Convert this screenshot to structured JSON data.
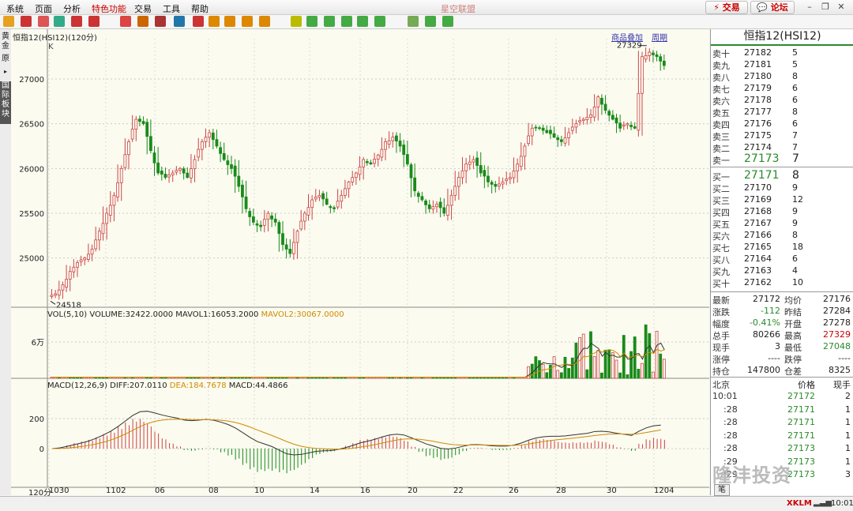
{
  "menu": {
    "items": [
      "系统",
      "页面",
      "分析",
      "特色功能",
      "交易",
      "工具",
      "帮助"
    ],
    "app_title": "星空联盟"
  },
  "topbar": {
    "trade_btn": "交易",
    "forum_btn": "论坛"
  },
  "sidebar": {
    "tab1": "黄金",
    "tab2": "原",
    "tab3": "国际板块"
  },
  "chart_header": {
    "title": "恒指12(HSI12)(120分)",
    "k_label": "K",
    "overlay": "商品叠加",
    "period": "周期",
    "yaxis_label": "120分"
  },
  "volume_header": {
    "prefix": "VOL(5,10)",
    "volume": "VOLUME:32422.0000",
    "mavol1": "MAVOL1:16053.2000",
    "mavol2": "MAVOL2:30067.0000",
    "tick": "6万"
  },
  "macd_header": {
    "prefix": "MACD(12,26,9)",
    "diff": "DIFF:207.0110",
    "dea": "DEA:184.7678",
    "macd": "MACD:44.4866"
  },
  "chart_data": {
    "type": "candlestick",
    "y_ticks": [
      25000,
      25500,
      26000,
      26500,
      27000
    ],
    "ylim": [
      24450,
      27450
    ],
    "x_labels": [
      "1030",
      "1102",
      "06",
      "08",
      "10",
      "14",
      "16",
      "20",
      "22",
      "26",
      "28",
      "30",
      "1204"
    ],
    "annotations": {
      "high": "27329",
      "low": "24518"
    },
    "close_path": [
      24600,
      24700,
      24850,
      24950,
      25000,
      25100,
      25300,
      25500,
      25700,
      26000,
      26300,
      26550,
      26500,
      26200,
      25950,
      25900,
      25950,
      26000,
      25900,
      26100,
      26300,
      26400,
      26250,
      26100,
      26000,
      25800,
      25550,
      25400,
      25350,
      25500,
      25400,
      25150,
      25050,
      25300,
      25500,
      25650,
      25700,
      25600,
      25550,
      25700,
      25850,
      25950,
      26100,
      26050,
      26150,
      26300,
      26350,
      26250,
      26050,
      25750,
      25650,
      25550,
      25600,
      25500,
      25700,
      25900,
      26050,
      26100,
      25950,
      25850,
      25800,
      25850,
      25900,
      26050,
      26250,
      26450,
      26450,
      26400,
      26350,
      26300,
      26400,
      26500,
      26550,
      26600,
      26800,
      26650,
      26550,
      26450,
      26500,
      26450,
      27250,
      27300,
      27250,
      27150
    ],
    "vol_ticks": [
      "6万"
    ],
    "macd_ticks": [
      200,
      0
    ]
  },
  "panel": {
    "title": "恒指12(HSI12)",
    "sells": [
      {
        "label": "卖十",
        "price": "27182",
        "vol": "5"
      },
      {
        "label": "卖九",
        "price": "27181",
        "vol": "5"
      },
      {
        "label": "卖八",
        "price": "27180",
        "vol": "8"
      },
      {
        "label": "卖七",
        "price": "27179",
        "vol": "6"
      },
      {
        "label": "卖六",
        "price": "27178",
        "vol": "6"
      },
      {
        "label": "卖五",
        "price": "27177",
        "vol": "8"
      },
      {
        "label": "卖四",
        "price": "27176",
        "vol": "6"
      },
      {
        "label": "卖三",
        "price": "27175",
        "vol": "7"
      },
      {
        "label": "卖二",
        "price": "27174",
        "vol": "7"
      },
      {
        "label": "卖一",
        "price": "27173",
        "vol": "7"
      }
    ],
    "buys": [
      {
        "label": "买一",
        "price": "27171",
        "vol": "8"
      },
      {
        "label": "买二",
        "price": "27170",
        "vol": "9"
      },
      {
        "label": "买三",
        "price": "27169",
        "vol": "12"
      },
      {
        "label": "买四",
        "price": "27168",
        "vol": "9"
      },
      {
        "label": "买五",
        "price": "27167",
        "vol": "9"
      },
      {
        "label": "买六",
        "price": "27166",
        "vol": "8"
      },
      {
        "label": "买七",
        "price": "27165",
        "vol": "18"
      },
      {
        "label": "买八",
        "price": "27164",
        "vol": "6"
      },
      {
        "label": "买九",
        "price": "27163",
        "vol": "4"
      },
      {
        "label": "买十",
        "price": "27162",
        "vol": "10"
      }
    ],
    "stats": [
      {
        "l1": "最新",
        "v1": "27172",
        "l2": "均价",
        "v2": "27176",
        "c1": "#222",
        "c2": "#222"
      },
      {
        "l1": "涨跌",
        "v1": "-112",
        "l2": "昨结",
        "v2": "27284",
        "c1": "#2a8a2a",
        "c2": "#222"
      },
      {
        "l1": "幅度",
        "v1": "-0.41%",
        "l2": "开盘",
        "v2": "27278",
        "c1": "#2a8a2a",
        "c2": "#222"
      },
      {
        "l1": "总手",
        "v1": "80266",
        "l2": "最高",
        "v2": "27329",
        "c1": "#222",
        "c2": "#c00"
      },
      {
        "l1": "现手",
        "v1": "3",
        "l2": "最低",
        "v2": "27048",
        "c1": "#222",
        "c2": "#2a8a2a"
      },
      {
        "l1": "涨停",
        "v1": "----",
        "l2": "跌停",
        "v2": "----",
        "c1": "#222",
        "c2": "#222"
      },
      {
        "l1": "持仓",
        "v1": "147800",
        "l2": "仓差",
        "v2": "8325",
        "c1": "#222",
        "c2": "#222"
      }
    ],
    "ticks_header": {
      "loc": "北京",
      "price": "价格",
      "vol": "现手"
    },
    "ticks": [
      {
        "time": "10:01",
        "price": "27172",
        "vol": "2"
      },
      {
        "time": ":28",
        "price": "27171",
        "vol": "1"
      },
      {
        "time": ":28",
        "price": "27171",
        "vol": "1"
      },
      {
        "time": ":28",
        "price": "27171",
        "vol": "1"
      },
      {
        "time": ":28",
        "price": "27173",
        "vol": "1"
      },
      {
        "time": ":29",
        "price": "27173",
        "vol": "1"
      },
      {
        "time": ":29",
        "price": "27173",
        "vol": "3"
      }
    ],
    "bottom_tab": "笔"
  },
  "status": {
    "brand": "XKLM",
    "time": "10:01"
  },
  "watermark": "隆沣投资"
}
